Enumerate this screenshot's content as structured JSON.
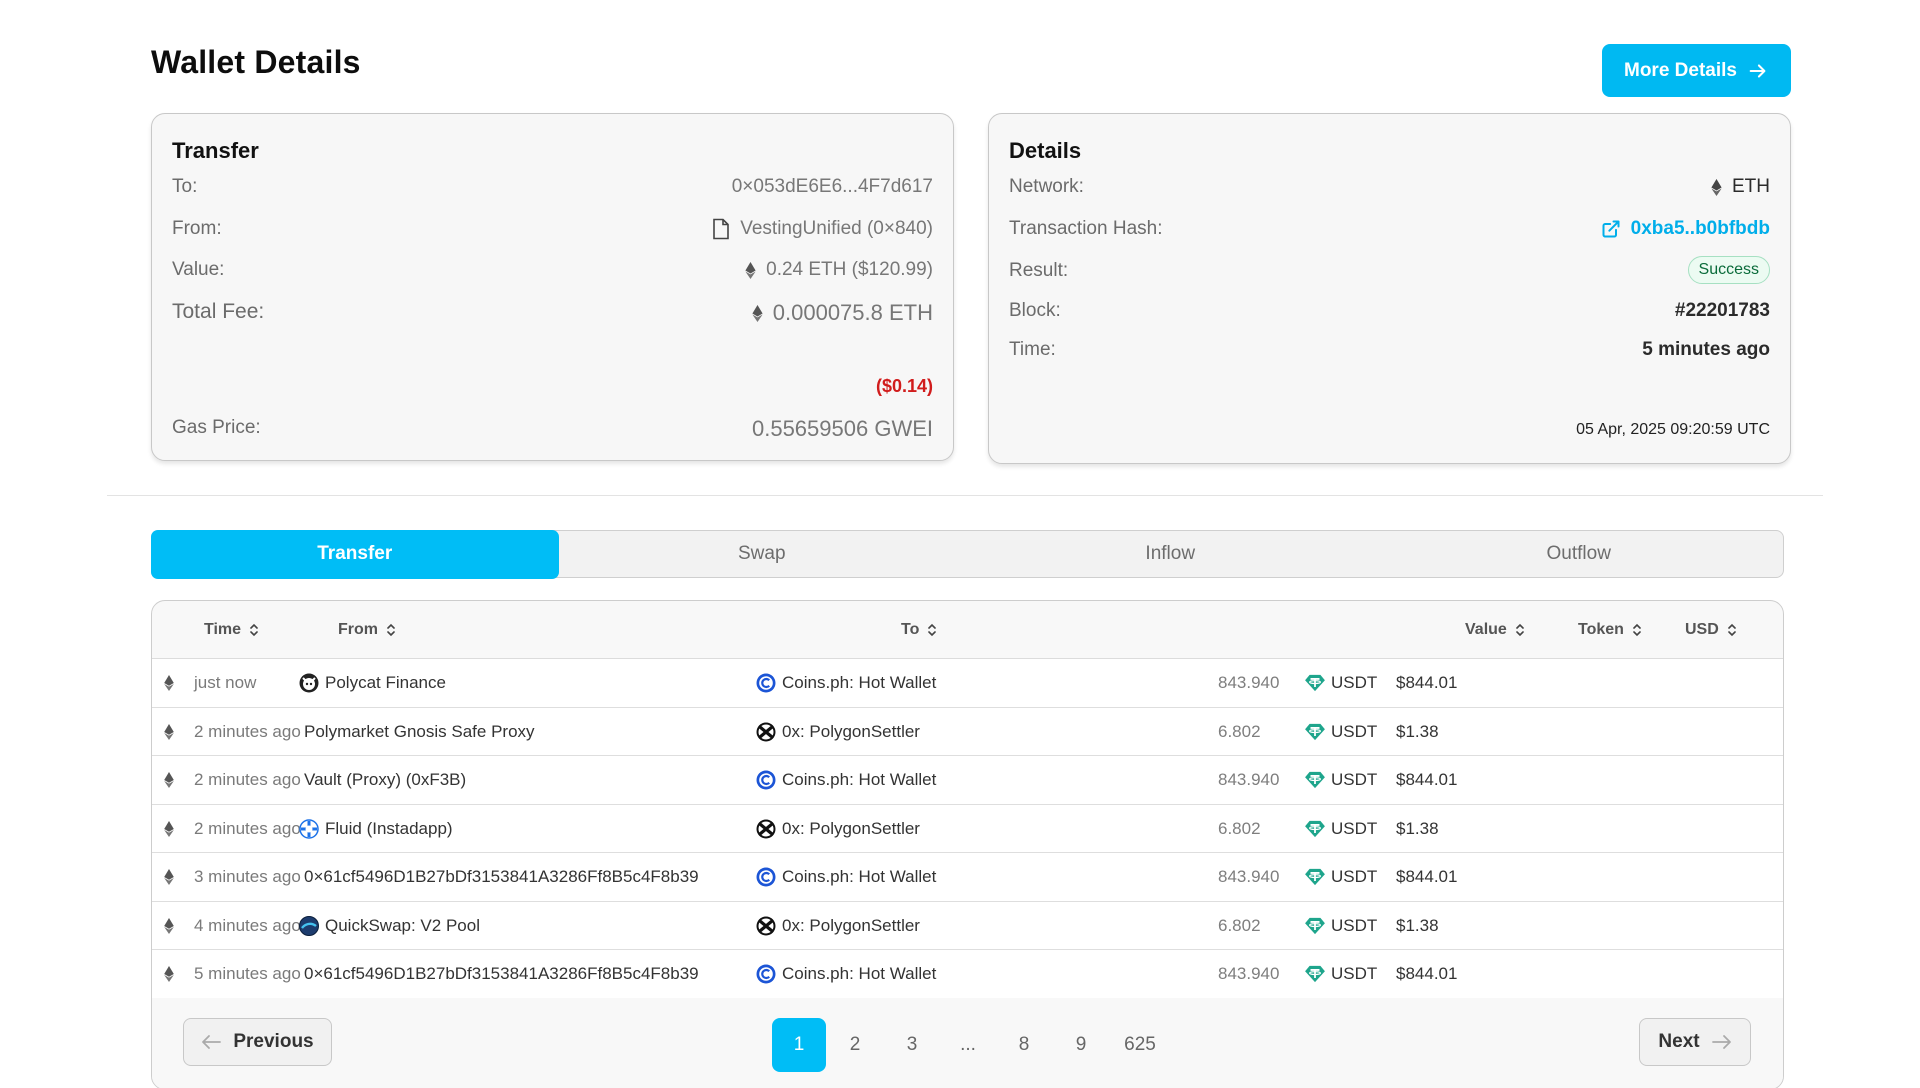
{
  "header": {
    "title": "Wallet Details",
    "more_details_label": "More Details"
  },
  "transfer_card": {
    "title": "Transfer",
    "to_label": "To:",
    "to_value": "0×053dE6E6...4F7d617",
    "from_label": "From:",
    "from_value": "VestingUnified (0×840)",
    "value_label": "Value:",
    "value_value": "0.24 ETH ($120.99)",
    "fee_label": "Total Fee:",
    "fee_value": "0.000075.8 ETH",
    "fee_usd": "($0.14)",
    "gas_label": "Gas Price:",
    "gas_value": "0.55659506 GWEI"
  },
  "details_card": {
    "title": "Details",
    "network_label": "Network:",
    "network_value": "ETH",
    "hash_label": "Transaction Hash:",
    "hash_value": "0xba5..b0bfbdb",
    "result_label": "Result:",
    "result_value": "Success",
    "block_label": "Block:",
    "block_value": "#22201783",
    "time_label": "Time:",
    "time_value": "5 minutes ago",
    "time_sub": "05 Apr, 2025 09:20:59 UTC"
  },
  "tabs": [
    "Transfer",
    "Swap",
    "Inflow",
    "Outflow"
  ],
  "table": {
    "headers": {
      "time": "Time",
      "from": "From",
      "to": "To",
      "value": "Value",
      "token": "Token",
      "usd": "USD"
    },
    "rows": [
      {
        "time": "just now",
        "from": "Polycat Finance",
        "from_icon": "polycat-icon",
        "to": "Coins.ph: Hot Wallet",
        "to_icon": "coins-ph-icon",
        "value": "843.940",
        "token": "USDT",
        "usd": "$844.01"
      },
      {
        "time": "2 minutes ago",
        "from": "Polymarket Gnosis Safe Proxy",
        "from_icon": "",
        "to": "0x: PolygonSettler",
        "to_icon": "0x-icon",
        "value": "6.802",
        "token": "USDT",
        "usd": "$1.38"
      },
      {
        "time": "2 minutes ago",
        "from": "Vault (Proxy) (0xF3B)",
        "from_icon": "",
        "to": "Coins.ph: Hot Wallet",
        "to_icon": "coins-ph-icon",
        "value": "843.940",
        "token": "USDT",
        "usd": "$844.01"
      },
      {
        "time": "2 minutes ago",
        "from": "Fluid (Instadapp)",
        "from_icon": "fluid-icon",
        "to": "0x: PolygonSettler",
        "to_icon": "0x-icon",
        "value": "6.802",
        "token": "USDT",
        "usd": "$1.38"
      },
      {
        "time": "3 minutes ago",
        "from": "0×61cf5496D1B27bDf3153841A3286Ff8B5c4F8b39",
        "from_icon": "",
        "to": "Coins.ph: Hot Wallet",
        "to_icon": "coins-ph-icon",
        "value": "843.940",
        "token": "USDT",
        "usd": "$844.01"
      },
      {
        "time": "4 minutes ago",
        "from": "QuickSwap: V2 Pool",
        "from_icon": "quickswap-icon",
        "to": "0x: PolygonSettler",
        "to_icon": "0x-icon",
        "value": "6.802",
        "token": "USDT",
        "usd": "$1.38"
      },
      {
        "time": "5 minutes ago",
        "from": "0×61cf5496D1B27bDf3153841A3286Ff8B5c4F8b39",
        "from_icon": "",
        "to": "Coins.ph: Hot Wallet",
        "to_icon": "coins-ph-icon",
        "value": "843.940",
        "token": "USDT",
        "usd": "$844.01"
      }
    ]
  },
  "pagination": {
    "previous_label": "Previous",
    "next_label": "Next",
    "pages": [
      "1",
      "2",
      "3",
      "...",
      "8",
      "9",
      "625"
    ],
    "current": "1"
  },
  "colors": {
    "accent": "#00bdf6",
    "fee_usd": "#d11c1c",
    "success_bg": "#ecfbf2",
    "usdt": "#1ea58c"
  }
}
